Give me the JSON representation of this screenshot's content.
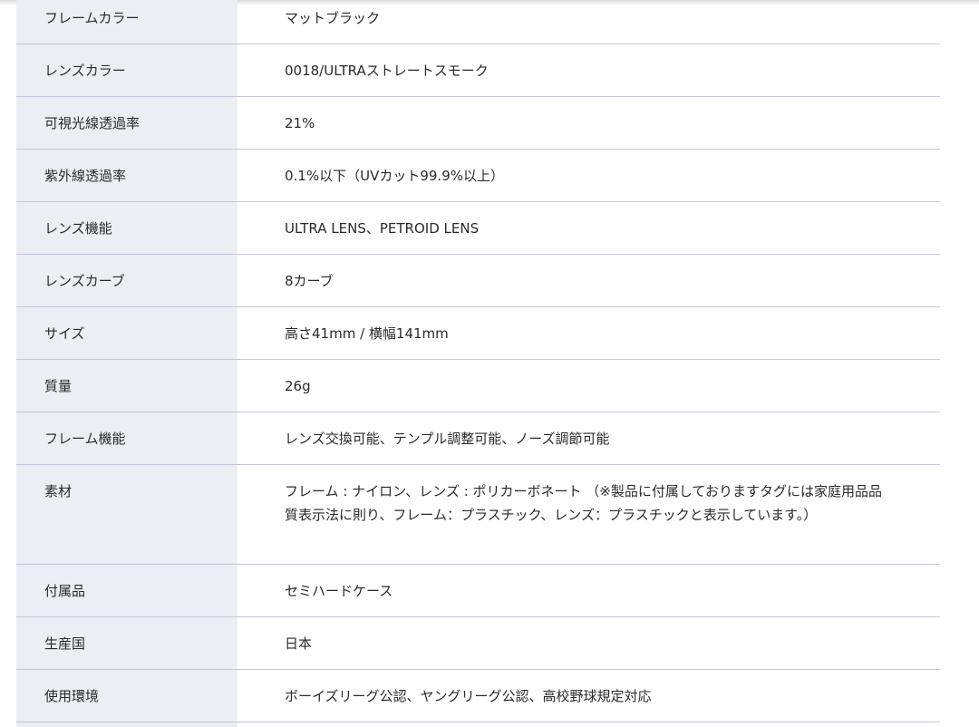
{
  "specs": [
    {
      "label": "フレームカラー",
      "value": "マットブラック"
    },
    {
      "label": "レンズカラー",
      "value": "0018/ULTRAストレートスモーク"
    },
    {
      "label": "可視光線透過率",
      "value": "21%"
    },
    {
      "label": "紫外線透過率",
      "value": "0.1%以下（UVカット99.9%以上）"
    },
    {
      "label": "レンズ機能",
      "value": "ULTRA LENS、PETROID LENS"
    },
    {
      "label": "レンズカーブ",
      "value": "8カーブ"
    },
    {
      "label": "サイズ",
      "value": "高さ41mm / 横幅141mm"
    },
    {
      "label": "質量",
      "value": "26g"
    },
    {
      "label": "フレーム機能",
      "value": "レンズ交換可能、テンプル調整可能、ノーズ調節可能"
    },
    {
      "label": "素材",
      "value": "フレーム : ナイロン、レンズ : ポリカーボネート （※製品に付属しておりますタグには家庭用品品質表示法に則り、フレーム：プラスチック、レンズ：プラスチックと表示しています。）"
    },
    {
      "label": "付属品",
      "value": "セミハードケース"
    },
    {
      "label": "生産国",
      "value": "日本"
    },
    {
      "label": "使用環境",
      "value": "ボーイズリーグ公認、ヤングリーグ公認、高校野球規定対応"
    }
  ]
}
